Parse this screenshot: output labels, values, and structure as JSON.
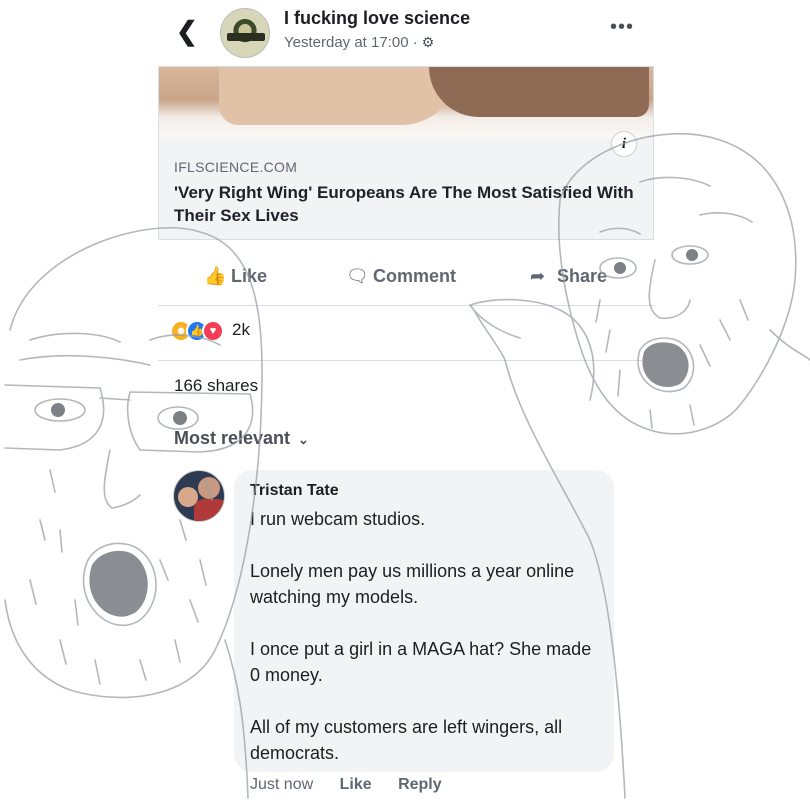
{
  "header": {
    "back_icon": "chevron-left-icon",
    "page_name": "I fucking love science",
    "timestamp": "Yesterday at 17:00 ·",
    "settings_icon": "gear-icon",
    "more_icon": "ellipsis-icon"
  },
  "preview": {
    "info_label": "i",
    "domain": "IFLSCIENCE.COM",
    "title": "'Very Right Wing' Europeans Are The Most Satisfied With Their Sex Lives"
  },
  "actions": {
    "like": "Like",
    "comment": "Comment",
    "share": "Share"
  },
  "reactions": {
    "icons": [
      "haha-icon",
      "like-icon",
      "love-icon"
    ],
    "count": "2k"
  },
  "shares": "166 shares",
  "sort": {
    "label": "Most relevant"
  },
  "comment": {
    "author": "Tristan Tate",
    "paragraphs": [
      "I run webcam studios.",
      "Lonely men pay us millions a year online watching my models.",
      "I once put a girl in a MAGA hat? She made 0 money."
    ],
    "last_paragraph": "All of my customers are left wingers, all democrats.",
    "time": "Just now",
    "like": "Like",
    "reply": "Reply"
  },
  "colors": {
    "link_gray": "#606770",
    "bubble": "#f2f3f5",
    "divider": "#dadde1",
    "like_blue": "#2078f4",
    "love_red": "#f33e58",
    "haha_yellow": "#f7b125"
  }
}
